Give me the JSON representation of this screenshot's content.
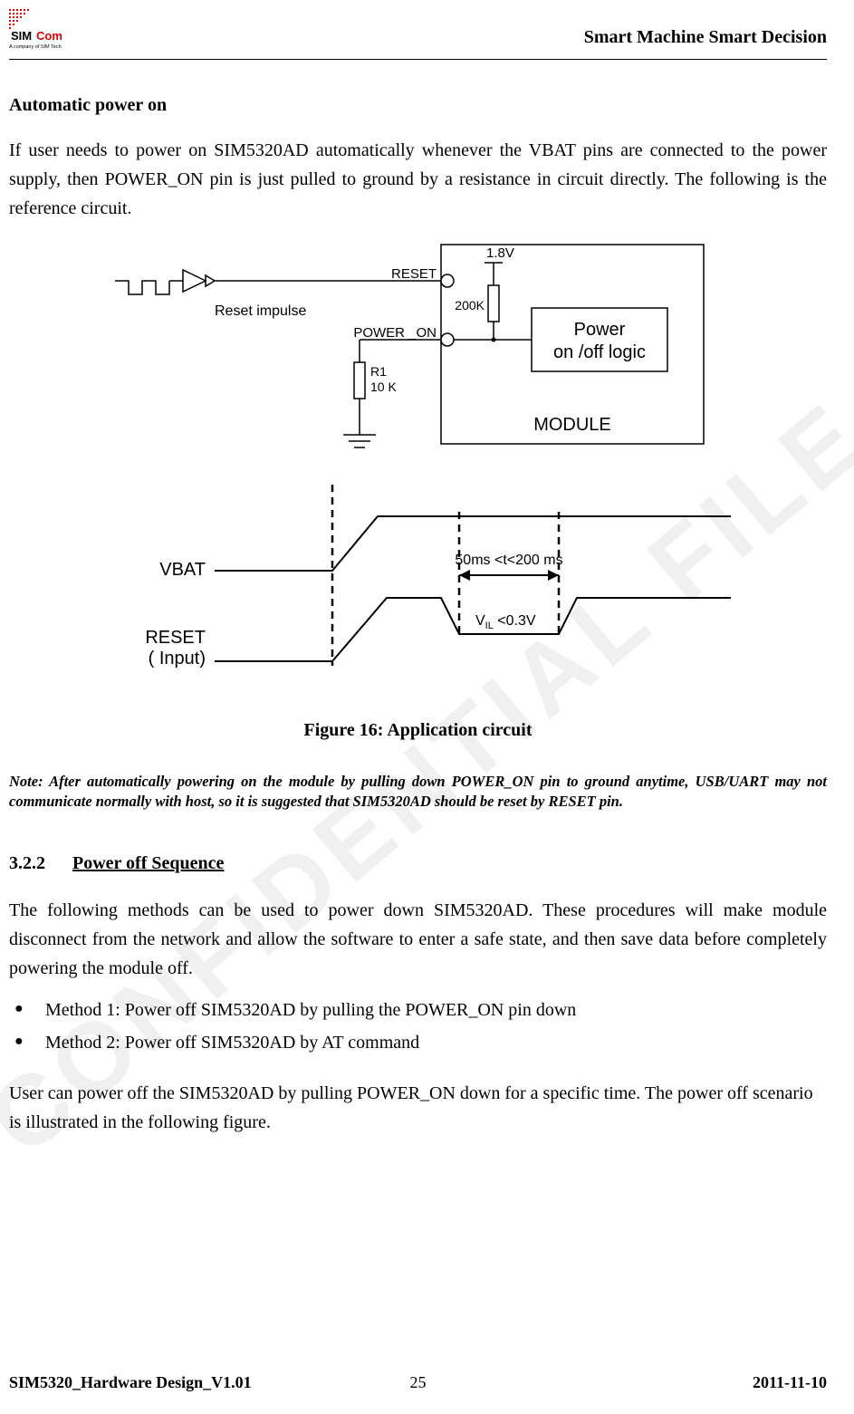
{
  "header": {
    "tagline": "Smart Machine Smart Decision",
    "logo_text_top": "SIMCom",
    "logo_text_bottom": "A company of SIM Tech"
  },
  "section_auto": {
    "title": "Automatic power on",
    "paragraph": "If user needs to power on SIM5320AD automatically whenever the VBAT pins are connected to the power supply, then POWER_ON pin is just pulled to ground by a resistance in circuit directly. The following is the reference circuit."
  },
  "figure": {
    "labels": {
      "reset_impulse": "Reset impulse",
      "reset": "RESET",
      "power_on": "POWER _ON",
      "r1_name": "R1",
      "r1_value": "10 K",
      "v18": "1.8V",
      "k200": "200K",
      "power_logic_top": "Power",
      "power_logic_bottom": "on /off logic",
      "module": "MODULE",
      "vbat": "VBAT",
      "reset_input_l1": "RESET",
      "reset_input_l2": "( Input)",
      "timing": "50ms <t<200 ms",
      "vil_prefix": "V",
      "vil_sub": "IL",
      "vil_rest": " <0.3V"
    },
    "caption": "Figure 16: Application circuit"
  },
  "note": "Note: After automatically powering on the module by pulling down POWER_ON pin to ground anytime, USB/UART may not communicate normally with host, so it is suggested that SIM5320AD should be reset by RESET pin.",
  "section_off": {
    "number": "3.2.2",
    "title": "Power off Sequence",
    "paragraph": "The following methods can be used to power down SIM5320AD. These procedures will make module disconnect from the network and allow the software to enter a safe state, and then save data before completely powering the module off.",
    "bullets": [
      "Method 1: Power off SIM5320AD by pulling the POWER_ON pin down",
      "Method 2: Power off SIM5320AD by AT command"
    ],
    "paragraph2": "User can power off the SIM5320AD by pulling POWER_ON down for a specific time. The power off scenario is illustrated in the following figure."
  },
  "footer": {
    "left": "SIM5320_Hardware Design_V1.01",
    "center": "25",
    "right": "2011-11-10"
  },
  "watermark": "CONFIDENTIAL FILE"
}
